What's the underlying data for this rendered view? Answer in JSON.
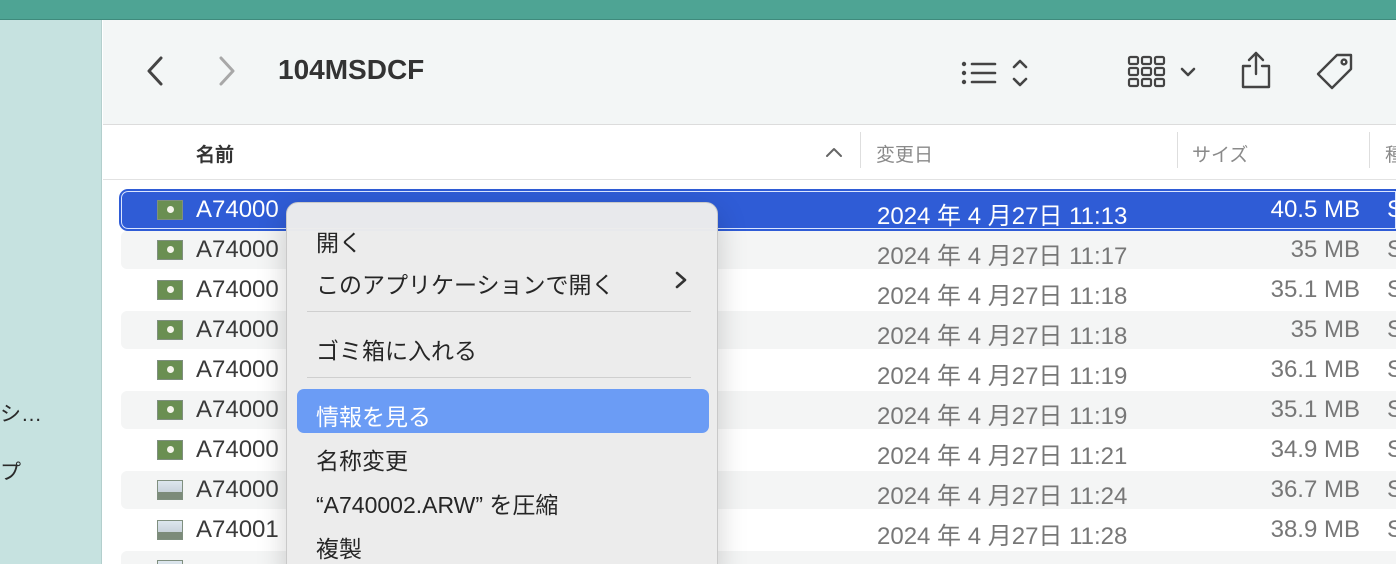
{
  "window": {
    "title": "104MSDCF"
  },
  "sidebar": {
    "items": [
      {
        "label": "シ…"
      },
      {
        "label": "プ"
      }
    ]
  },
  "toolbar": {
    "back_icon": "chevron-left-icon",
    "forward_icon": "chevron-right-icon",
    "view_icon": "list-view-icon",
    "group_icon": "grid-group-icon",
    "share_icon": "share-icon",
    "tag_icon": "tag-icon"
  },
  "columns": {
    "name": "名前",
    "modified": "変更日",
    "size": "サイズ",
    "kind": "種"
  },
  "files": [
    {
      "name": "A74000",
      "date": "2024 年 4 月27日 11:13",
      "size": "40.5 MB",
      "kind": "S"
    },
    {
      "name": "A74000",
      "date": "2024 年 4 月27日 11:17",
      "size": "35 MB",
      "kind": "S"
    },
    {
      "name": "A74000",
      "date": "2024 年 4 月27日 11:18",
      "size": "35.1 MB",
      "kind": "S"
    },
    {
      "name": "A74000",
      "date": "2024 年 4 月27日 11:18",
      "size": "35 MB",
      "kind": "S"
    },
    {
      "name": "A74000",
      "date": "2024 年 4 月27日 11:19",
      "size": "36.1 MB",
      "kind": "S"
    },
    {
      "name": "A74000",
      "date": "2024 年 4 月27日 11:19",
      "size": "35.1 MB",
      "kind": "S"
    },
    {
      "name": "A74000",
      "date": "2024 年 4 月27日 11:21",
      "size": "34.9 MB",
      "kind": "S"
    },
    {
      "name": "A74000",
      "date": "2024 年 4 月27日 11:24",
      "size": "36.7 MB",
      "kind": "S"
    },
    {
      "name": "A74001",
      "date": "2024 年 4 月27日 11:28",
      "size": "38.9 MB",
      "kind": "S"
    }
  ],
  "context_menu": {
    "items": [
      {
        "label": "開く"
      },
      {
        "label": "このアプリケーションで開く"
      },
      {
        "label": "ゴミ箱に入れる"
      },
      {
        "label": "情報を見る"
      },
      {
        "label": "名称変更"
      },
      {
        "label": "“A740002.ARW” を圧縮"
      },
      {
        "label": "複製"
      }
    ]
  },
  "colors": {
    "selection": "#2f5cd6",
    "menu_highlight": "#6b9cf5",
    "sidebar": "#c6e2e0",
    "titlebar": "#4ea494"
  }
}
